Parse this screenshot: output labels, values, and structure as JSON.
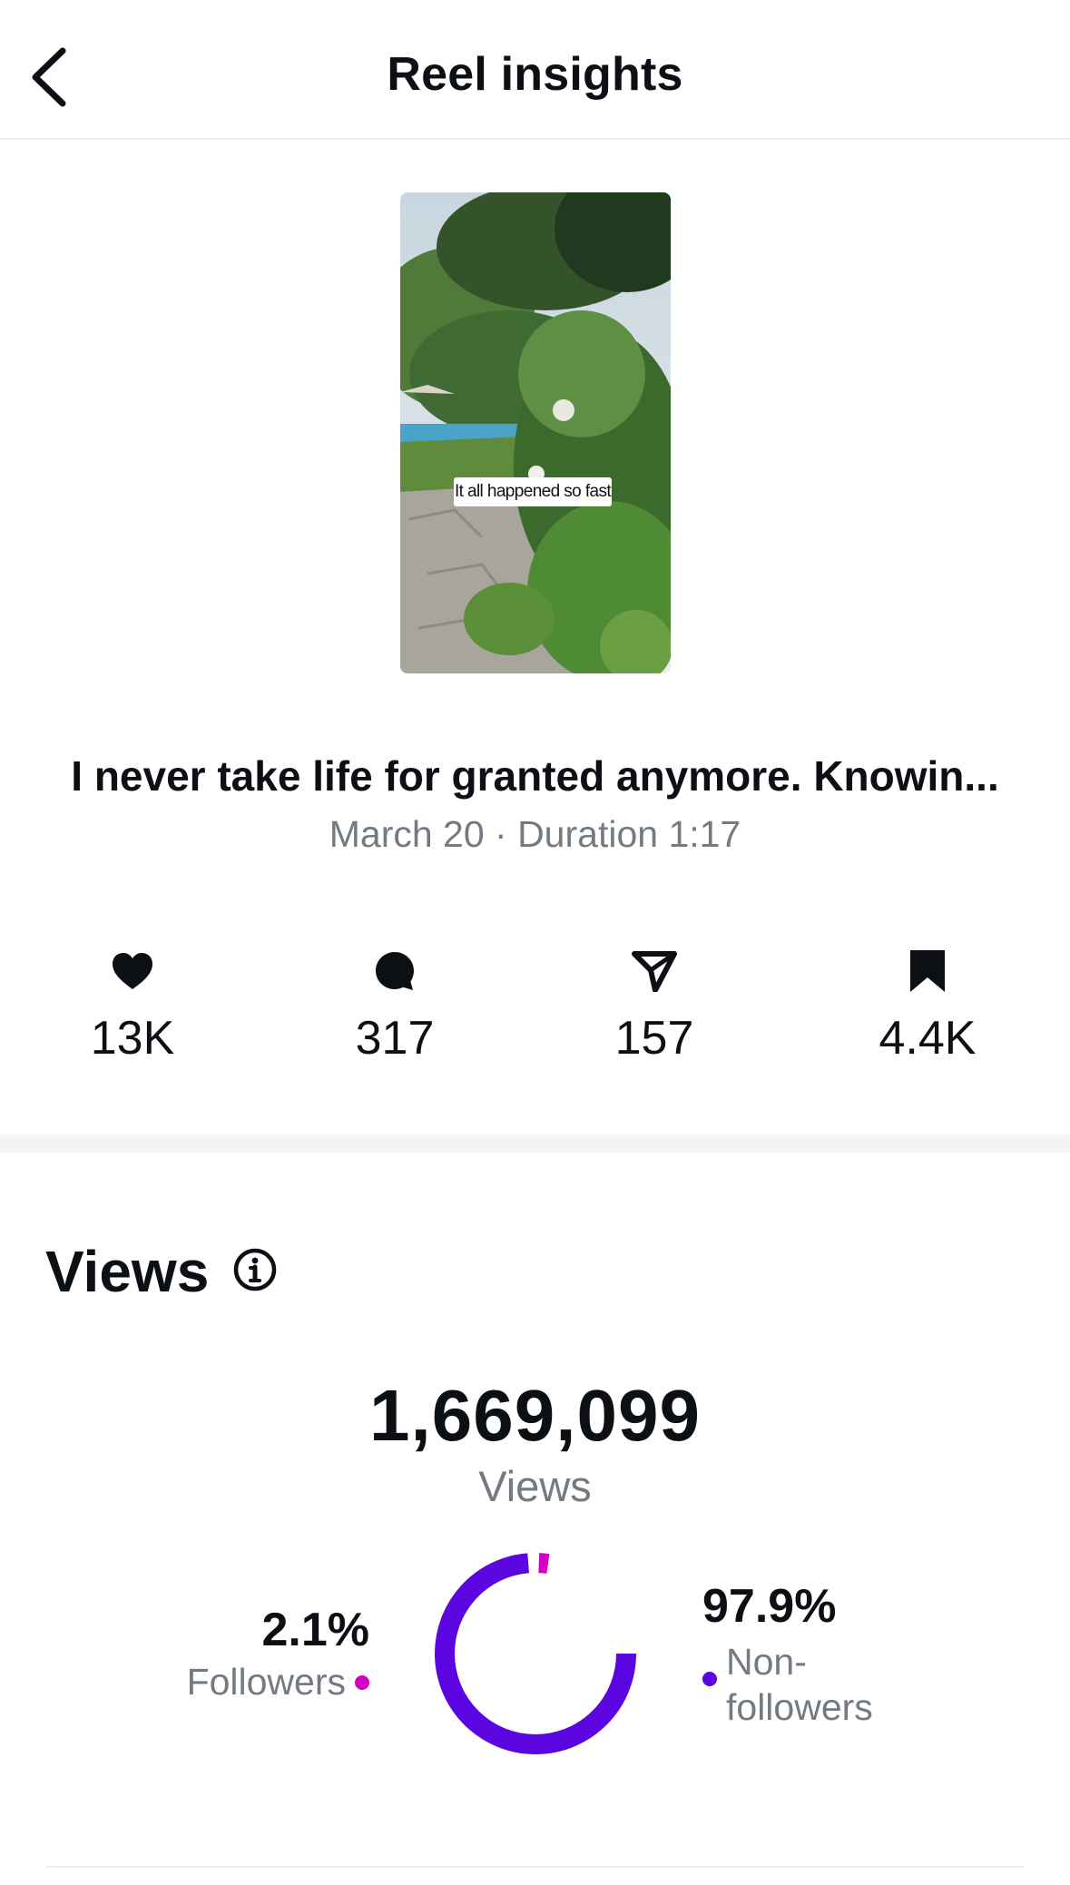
{
  "header": {
    "title": "Reel insights",
    "back_icon": "chevron-left-icon"
  },
  "thumbnail": {
    "caption_sticker": "It all happened so fast"
  },
  "reel": {
    "caption": "I never take life for granted anymore. Knowin...",
    "meta": "March 20 · Duration 1:17"
  },
  "stats": [
    {
      "icon": "heart-icon",
      "value": "13K"
    },
    {
      "icon": "comment-icon",
      "value": "317"
    },
    {
      "icon": "share-icon",
      "value": "157"
    },
    {
      "icon": "bookmark-icon",
      "value": "4.4K"
    }
  ],
  "views": {
    "section_title": "Views",
    "info_icon": "info-icon",
    "total": "1,669,099",
    "total_label": "Views",
    "followers": {
      "percent_label": "2.1%",
      "label": "Followers",
      "value": 2.1,
      "color": "#d300c5"
    },
    "non_followers": {
      "percent_label": "97.9%",
      "label": "Non-followers",
      "label_display": "Non- followers",
      "value": 97.9,
      "color": "#5b06e0"
    }
  }
}
